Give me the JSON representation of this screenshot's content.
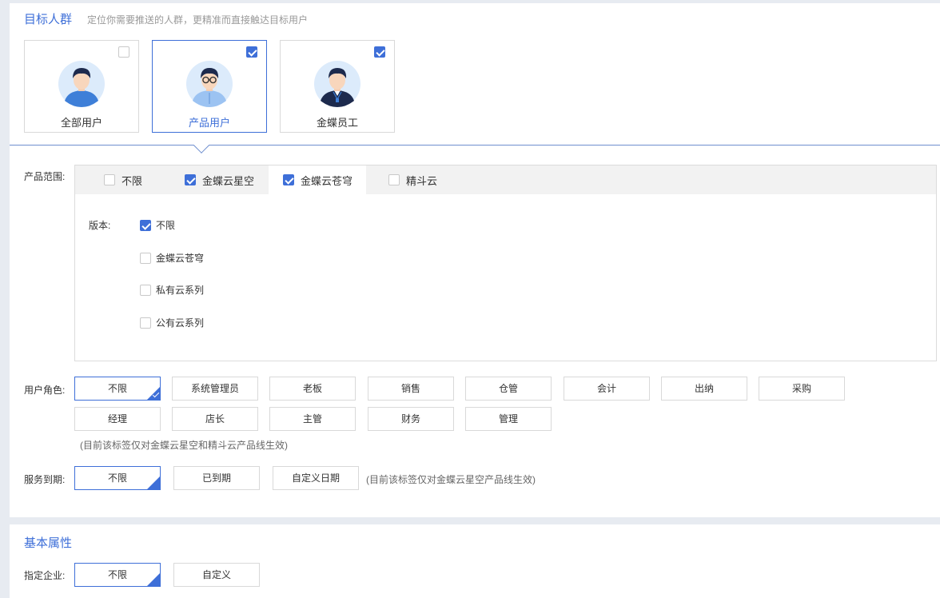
{
  "target_group": {
    "title": "目标人群",
    "subtitle": "定位你需要推送的人群，更精准而直接触达目标用户",
    "cards": [
      {
        "label": "全部用户",
        "checked": false,
        "avatar": "user-avatar-icon"
      },
      {
        "label": "产品用户",
        "checked": true,
        "avatar": "glasses-user-avatar-icon"
      },
      {
        "label": "金蝶员工",
        "checked": true,
        "avatar": "employee-badge-avatar-icon"
      }
    ]
  },
  "product_scope": {
    "label": "产品范围:",
    "tabs": [
      {
        "label": "不限",
        "checked": false
      },
      {
        "label": "金蝶云星空",
        "checked": true
      },
      {
        "label": "金蝶云苍穹",
        "checked": true,
        "active": true
      },
      {
        "label": "精斗云",
        "checked": false
      }
    ],
    "version_label": "版本:",
    "versions": [
      {
        "label": "不限",
        "checked": true
      },
      {
        "label": "金蝶云苍穹",
        "checked": false
      },
      {
        "label": "私有云系列",
        "checked": false
      },
      {
        "label": "公有云系列",
        "checked": false
      }
    ]
  },
  "user_role": {
    "label": "用户角色:",
    "options": [
      "不限",
      "系统管理员",
      "老板",
      "销售",
      "仓管",
      "会计",
      "出纳",
      "采购",
      "经理",
      "店长",
      "主管",
      "财务",
      "管理"
    ],
    "selected": "不限",
    "note": "(目前该标签仅对金蝶云星空和精斗云产品线生效)"
  },
  "service_expiry": {
    "label": "服务到期:",
    "options": [
      "不限",
      "已到期",
      "自定义日期"
    ],
    "selected": "不限",
    "note": "(目前该标签仅对金蝶云星空产品线生效)"
  },
  "basic_attributes": {
    "title": "基本属性",
    "enterprise_label": "指定企业:",
    "options": [
      "不限",
      "自定义"
    ],
    "selected": "不限"
  },
  "colors": {
    "accent": "#3e6fd8",
    "border": "#d9d9d9",
    "background": "#e7ebf1"
  }
}
